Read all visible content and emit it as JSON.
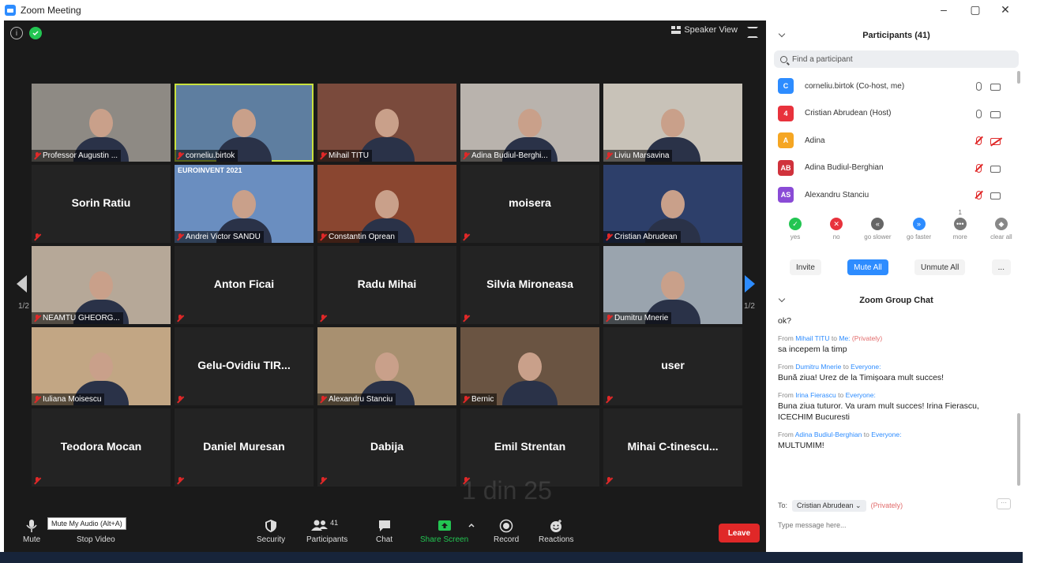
{
  "window": {
    "title": "Zoom Meeting",
    "minimize": "–",
    "maximize": "▢",
    "close": "✕"
  },
  "top_bar": {
    "speaker_view": "Speaker View"
  },
  "grid": {
    "tiles": [
      {
        "name": "Professor Augustin ...",
        "type": "video",
        "bg": "#8e8a84"
      },
      {
        "name": "corneliu.birtok",
        "type": "video",
        "bg": "#5e7ea0",
        "active": true
      },
      {
        "name": "Mihail TITU",
        "type": "video",
        "bg": "#7a4a3c"
      },
      {
        "name": "Adina Budiul-Berghi...",
        "type": "video",
        "bg": "#b9b3ad"
      },
      {
        "name": "Liviu Marsavina",
        "type": "video",
        "bg": "#c8c2b8"
      },
      {
        "name": "Sorin Ratiu",
        "type": "name"
      },
      {
        "name": "Andrei Victor SANDU",
        "type": "video",
        "bg": "#6a8ec0",
        "banner": "EUROINVENT 2021"
      },
      {
        "name": "Constantin Oprean",
        "type": "video",
        "bg": "#8a4630"
      },
      {
        "name": "moisera",
        "type": "name"
      },
      {
        "name": "Cristian Abrudean",
        "type": "video",
        "bg": "#2d3f6a"
      },
      {
        "name": "NEAMTU GHEORG...",
        "type": "video",
        "bg": "#b6a898"
      },
      {
        "name": "Anton Ficai",
        "type": "name"
      },
      {
        "name": "Radu Mihai",
        "type": "name"
      },
      {
        "name": "Silvia Mironeasa",
        "type": "name"
      },
      {
        "name": "Dumitru Mnerie",
        "type": "video",
        "bg": "#9aa4ae"
      },
      {
        "name": "Iuliana Moisescu",
        "type": "video",
        "bg": "#c2a684"
      },
      {
        "name": "Gelu-Ovidiu TIR...",
        "type": "name"
      },
      {
        "name": "Alexandru Stanciu",
        "type": "video",
        "bg": "#a89070"
      },
      {
        "name": "Bernic",
        "type": "video",
        "bg": "#6a5442"
      },
      {
        "name": "user",
        "type": "name"
      },
      {
        "name": "Teodora Mocan",
        "type": "name"
      },
      {
        "name": "Daniel Muresan",
        "type": "name"
      },
      {
        "name": "Dabija",
        "type": "name"
      },
      {
        "name": "Emil Strentan",
        "type": "name"
      },
      {
        "name": "Mihai C-tinescu...",
        "type": "name"
      }
    ],
    "page_left": "1/2",
    "page_right": "1/2",
    "watermark": "1 din 25"
  },
  "toolbar": {
    "mute": "Mute",
    "tooltip": "Mute My Audio (Alt+A)",
    "stop_video": "Stop Video",
    "security": "Security",
    "participants": "Participants",
    "participants_count": "41",
    "chat": "Chat",
    "share_screen": "Share Screen",
    "record": "Record",
    "reactions": "Reactions",
    "leave": "Leave"
  },
  "participants_panel": {
    "title": "Participants (41)",
    "search_placeholder": "Find a participant",
    "items": [
      {
        "initials": "C",
        "color": "#2d8cff",
        "name": "corneliu.birtok (Co-host, me)",
        "mic_muted": false,
        "cam_muted": false
      },
      {
        "initials": "4",
        "color": "#e8323c",
        "name": "Cristian Abrudean (Host)",
        "mic_muted": false,
        "cam_muted": false
      },
      {
        "initials": "A",
        "color": "#f5a623",
        "name": "Adina",
        "mic_muted": true,
        "cam_muted": true
      },
      {
        "initials": "AB",
        "color": "#d0323c",
        "name": "Adina Budiul-Berghian",
        "mic_muted": true,
        "cam_muted": false
      },
      {
        "initials": "AS",
        "color": "#8a4bd6",
        "name": "Alexandru Stanciu",
        "mic_muted": true,
        "cam_muted": false
      }
    ],
    "reactions": [
      {
        "label": "yes",
        "color": "#23c552",
        "glyph": "✓"
      },
      {
        "label": "no",
        "color": "#e8323c",
        "glyph": "✕"
      },
      {
        "label": "go slower",
        "color": "#666666",
        "glyph": "«"
      },
      {
        "label": "go faster",
        "color": "#2d8cff",
        "glyph": "»"
      },
      {
        "label": "more",
        "color": "#777777",
        "glyph": "•••"
      },
      {
        "label": "clear all",
        "color": "#888888",
        "glyph": "◆"
      }
    ],
    "more_count": "1",
    "invite": "Invite",
    "mute_all": "Mute All",
    "unmute_all": "Unmute All",
    "more_btn": "..."
  },
  "chat_panel": {
    "title": "Zoom Group Chat",
    "partial_top": "ok?",
    "messages": [
      {
        "from": "Mihail TITU",
        "to": "Me:",
        "private": "(Privately)",
        "text": "sa incepem la timp"
      },
      {
        "from": "Dumitru Mnerie",
        "to": "Everyone:",
        "private": "",
        "text": "Bună ziua! Urez de la Timișoara mult succes!"
      },
      {
        "from": "Irina Fierascu",
        "to": "Everyone:",
        "private": "",
        "text": "Buna ziua tuturor. Va uram mult succes! Irina Fierascu, ICECHIM Bucuresti"
      },
      {
        "from": "Adina Budiul-Berghian",
        "to": "Everyone:",
        "private": "",
        "text": "MULTUMIM!"
      }
    ],
    "from_word": "From",
    "to_word": "to",
    "to_label": "To:",
    "recipient": "Cristian Abrudean ⌄",
    "private": "(Privately)",
    "more": "···",
    "placeholder": "Type message here..."
  }
}
